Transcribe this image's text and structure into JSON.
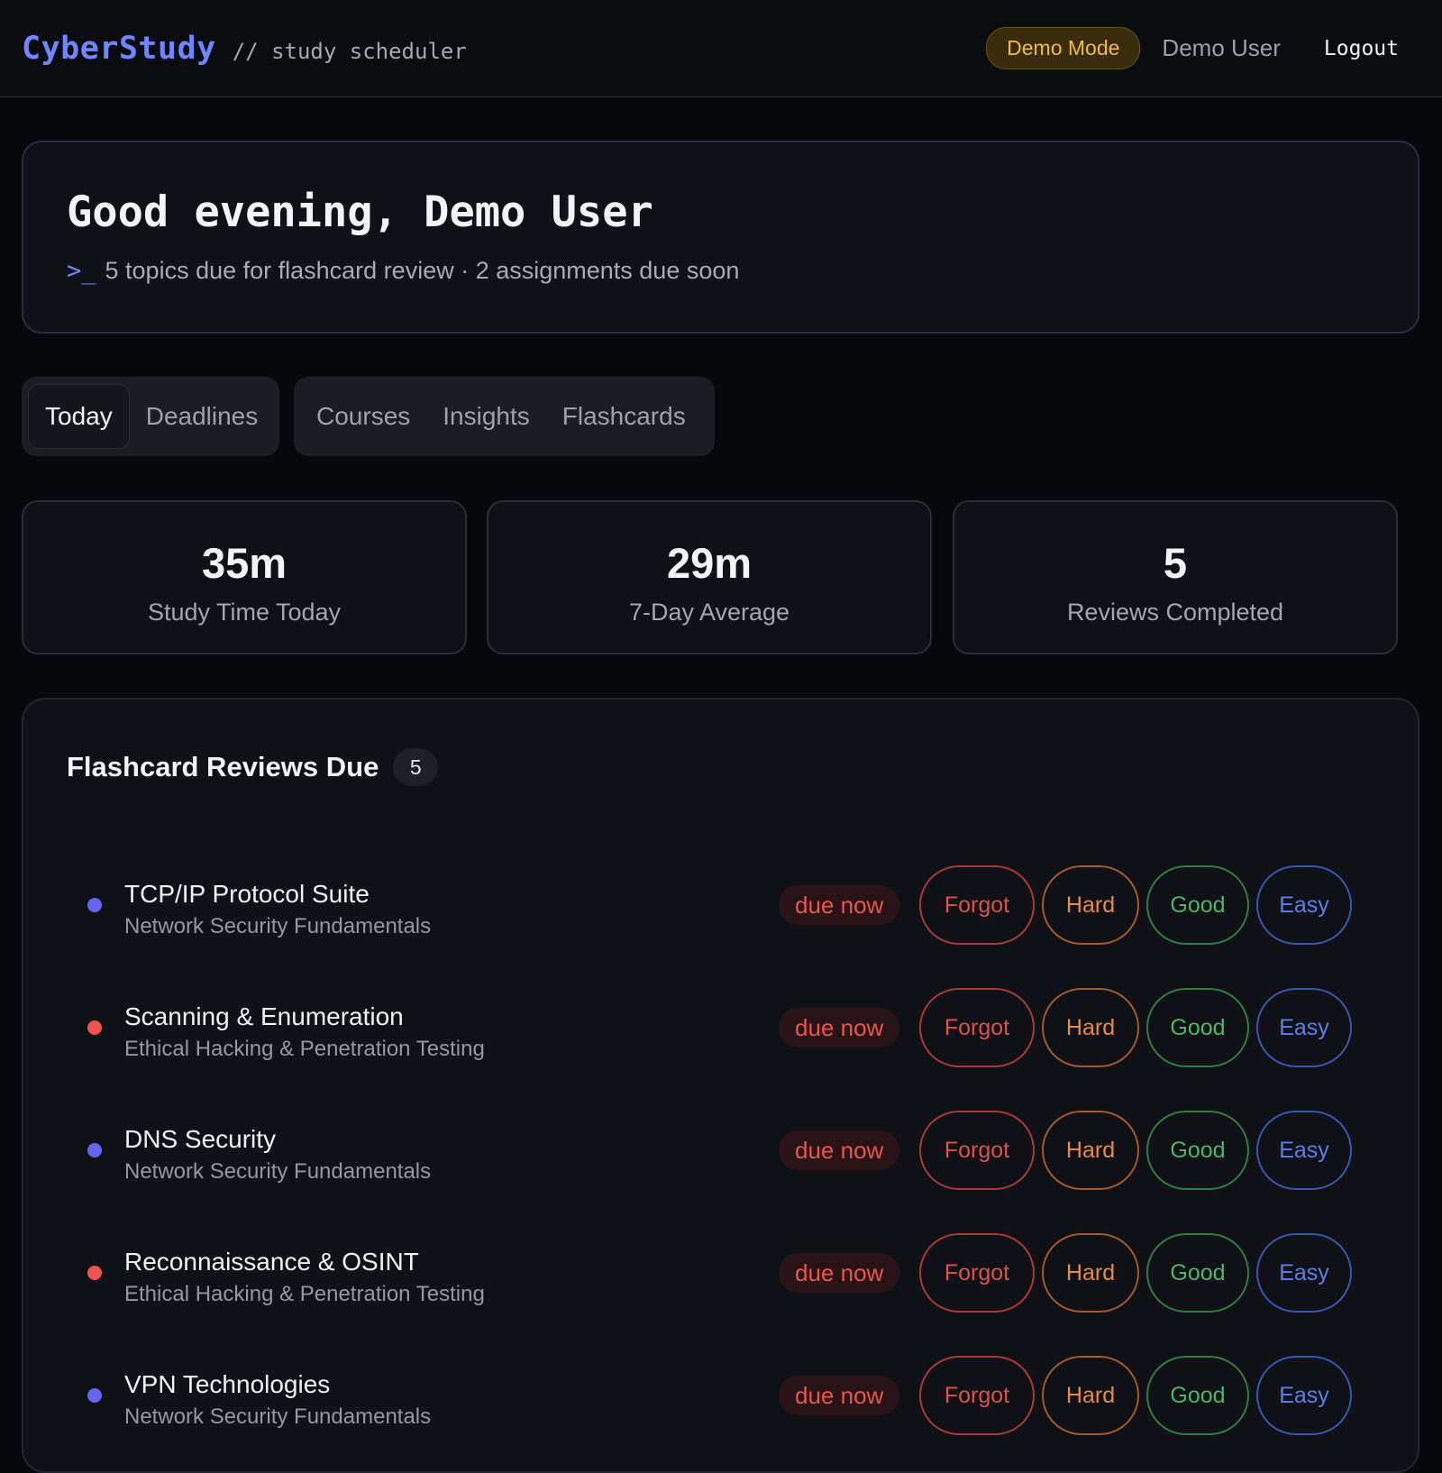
{
  "header": {
    "brand": "CyberStudy",
    "subtitle": "// study scheduler",
    "demo_badge": "Demo Mode",
    "user_name": "Demo User",
    "logout": "Logout"
  },
  "greeting": {
    "title": "Good evening, Demo User",
    "prompt": ">_",
    "subtitle": "5 topics due for flashcard review · 2 assignments due soon"
  },
  "tabs": {
    "group1": [
      "Today",
      "Deadlines"
    ],
    "group2": [
      "Courses",
      "Insights",
      "Flashcards"
    ],
    "active": "Today"
  },
  "stats": [
    {
      "value": "35m",
      "label": "Study Time Today"
    },
    {
      "value": "29m",
      "label": "7-Day Average"
    },
    {
      "value": "5",
      "label": "Reviews Completed"
    }
  ],
  "reviews": {
    "title": "Flashcard Reviews Due",
    "count": "5",
    "buttons": {
      "forgot": "Forgot",
      "hard": "Hard",
      "good": "Good",
      "easy": "Easy"
    },
    "items": [
      {
        "title": "TCP/IP Protocol Suite",
        "course": "Network Security Fundamentals",
        "status": "due now",
        "dot_color": "#6366f1"
      },
      {
        "title": "Scanning & Enumeration",
        "course": "Ethical Hacking & Penetration Testing",
        "status": "due now",
        "dot_color": "#ef5350"
      },
      {
        "title": "DNS Security",
        "course": "Network Security Fundamentals",
        "status": "due now",
        "dot_color": "#6366f1"
      },
      {
        "title": "Reconnaissance & OSINT",
        "course": "Ethical Hacking & Penetration Testing",
        "status": "due now",
        "dot_color": "#ef5350"
      },
      {
        "title": "VPN Technologies",
        "course": "Network Security Fundamentals",
        "status": "due now",
        "dot_color": "#6366f1"
      }
    ]
  },
  "colors": {
    "accent": "#6e86ff",
    "demo": "#f2bd3f",
    "forgot": "#e0504b",
    "hard": "#e98a3e",
    "good": "#47b868",
    "easy": "#5c7df0"
  }
}
